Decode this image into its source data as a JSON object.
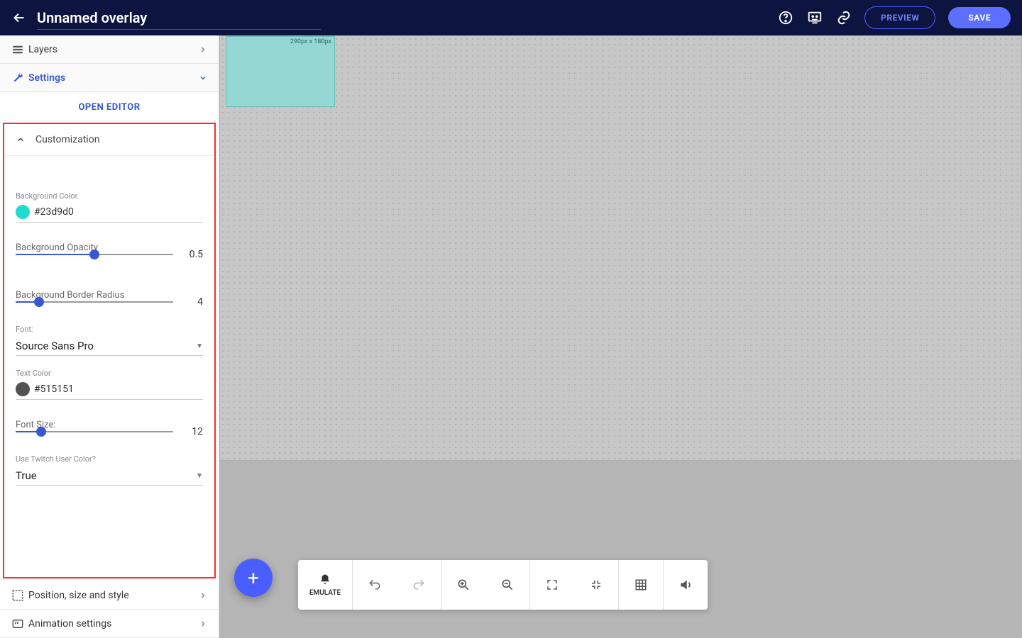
{
  "header": {
    "title": "Unnamed overlay",
    "preview": "PREVIEW",
    "save": "SAVE"
  },
  "sidebar": {
    "layers": "Layers",
    "settings": "Settings",
    "open_editor": "OPEN EDITOR",
    "customization": "Customization",
    "bg_color_label": "Background Color",
    "bg_color_value": "#23d9d0",
    "bg_opacity_label": "Background Opacity",
    "bg_opacity_value": "0.5",
    "bg_radius_label": "Background Border Radius",
    "bg_radius_value": "4",
    "font_label": "Font:",
    "font_value": "Source Sans Pro",
    "text_color_label": "Text Color",
    "text_color_value": "#515151",
    "font_size_label": "Font Size:",
    "font_size_value": "12",
    "twitch_label": "Use Twitch User Color?",
    "twitch_value": "True",
    "position": "Position, size and style",
    "animation": "Animation settings"
  },
  "canvas": {
    "overlay_dims": "290px x 180px"
  },
  "toolbar": {
    "emulate": "EMULATE"
  }
}
